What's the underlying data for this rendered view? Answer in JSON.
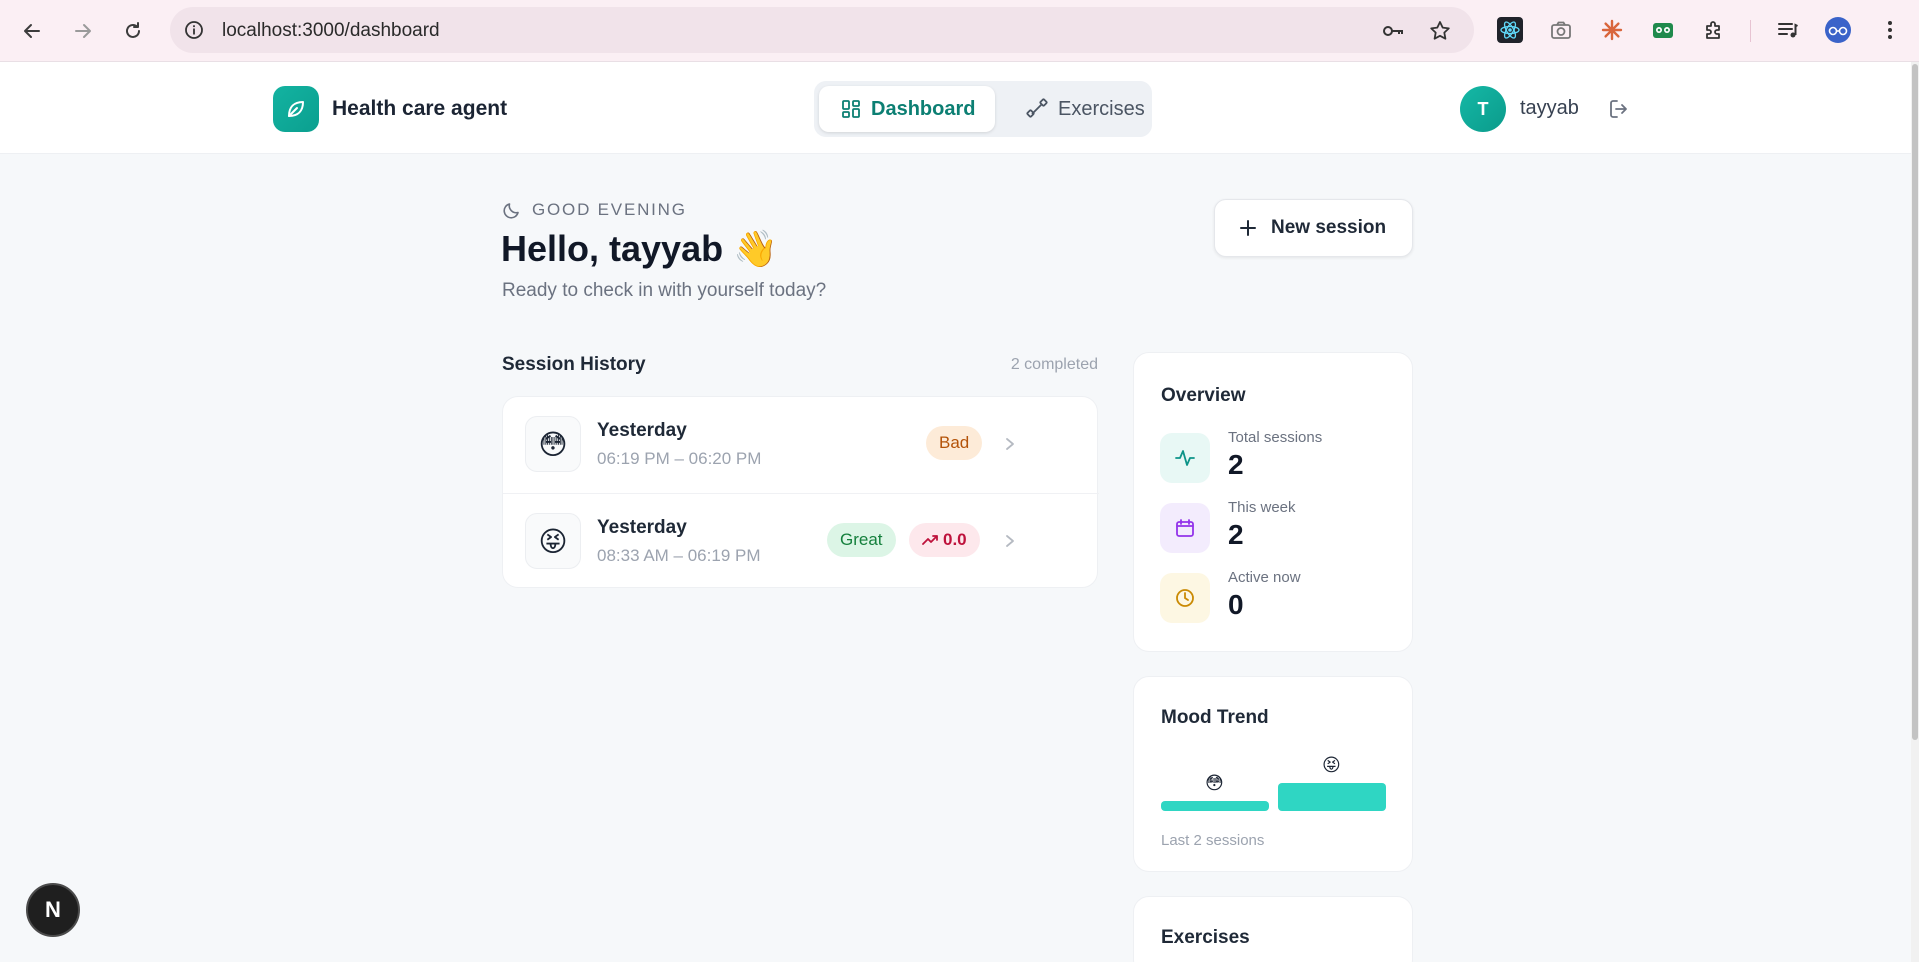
{
  "browser": {
    "url": "localhost:3000/dashboard"
  },
  "header": {
    "brand": "Health care agent",
    "tabs": [
      {
        "label": "Dashboard",
        "active": true
      },
      {
        "label": "Exercises",
        "active": false
      }
    ],
    "avatar_initial": "T",
    "username": "tayyab"
  },
  "greeting": {
    "label": "GOOD EVENING",
    "hello": "Hello, tayyab 👋",
    "subtitle": "Ready to check in with yourself today?",
    "new_session_label": "New session"
  },
  "history": {
    "title": "Session History",
    "count": "2 completed",
    "sessions": [
      {
        "emoji": "😳",
        "title": "Yesterday",
        "time": "06:19 PM – 06:20 PM",
        "mood": "Bad"
      },
      {
        "emoji": "😝",
        "title": "Yesterday",
        "time": "08:33 AM – 06:19 PM",
        "mood": "Great",
        "delta": "0.0"
      }
    ]
  },
  "overview": {
    "title": "Overview",
    "stats": [
      {
        "label": "Total sessions",
        "value": "2",
        "icon": "activity-icon"
      },
      {
        "label": "This week",
        "value": "2",
        "icon": "calendar-icon"
      },
      {
        "label": "Active now",
        "value": "0",
        "icon": "clock-icon"
      }
    ]
  },
  "mood_trend": {
    "title": "Mood Trend",
    "bars": [
      {
        "emoji": "😳",
        "level": 0.25
      },
      {
        "emoji": "😝",
        "level": 0.7
      }
    ],
    "footer": "Last 2 sessions"
  },
  "exercises_card": {
    "title": "Exercises"
  },
  "dev_badge": "N",
  "colors": {
    "accent": "#0c7f73",
    "brand_gradient": "#13b3a1",
    "bar": "#2fd6c3",
    "bad_badge_bg": "#fdebd8",
    "great_badge_bg": "#dcf5e6"
  }
}
